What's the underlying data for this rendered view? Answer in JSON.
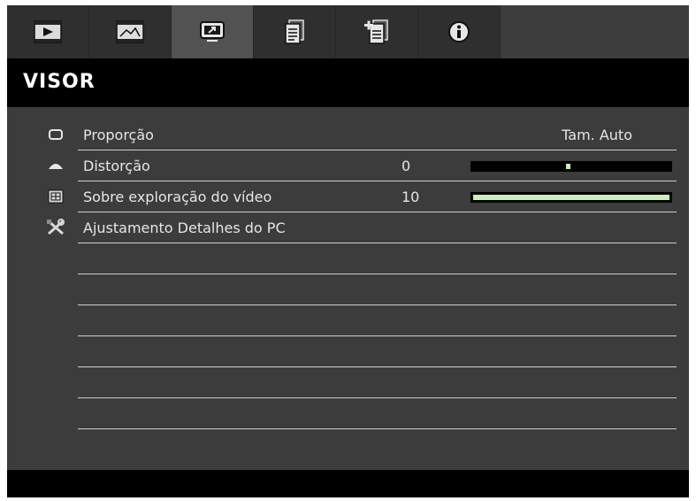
{
  "tabs": [
    {
      "icon": "play-screen-icon",
      "active": false
    },
    {
      "icon": "picture-image-icon",
      "active": false
    },
    {
      "icon": "display-screen-icon",
      "active": true
    },
    {
      "icon": "document-settings-icon",
      "active": false
    },
    {
      "icon": "document-add-icon",
      "active": false
    },
    {
      "icon": "info-circle-icon",
      "active": false
    }
  ],
  "menu": {
    "title": "VISOR"
  },
  "rows": [
    {
      "icon": "aspect-ratio-icon",
      "label": "Proporção",
      "value": "Tam. Auto"
    },
    {
      "icon": "keystone-trapezoid-icon",
      "label": "Distorção",
      "value": "0",
      "slider_fraction": 0.5
    },
    {
      "icon": "overscan-icon",
      "label": "Sobre exploração do vídeo",
      "value": "10",
      "slider_fraction": 1.0
    },
    {
      "icon": "tools-wrench-icon",
      "label": "Ajustamento Detalhes do PC"
    }
  ],
  "colors": {
    "background": "#3c3c3c",
    "title_bar": "#000000",
    "slider_fill": "#c9f0b6",
    "text": "#e6e6e6"
  }
}
